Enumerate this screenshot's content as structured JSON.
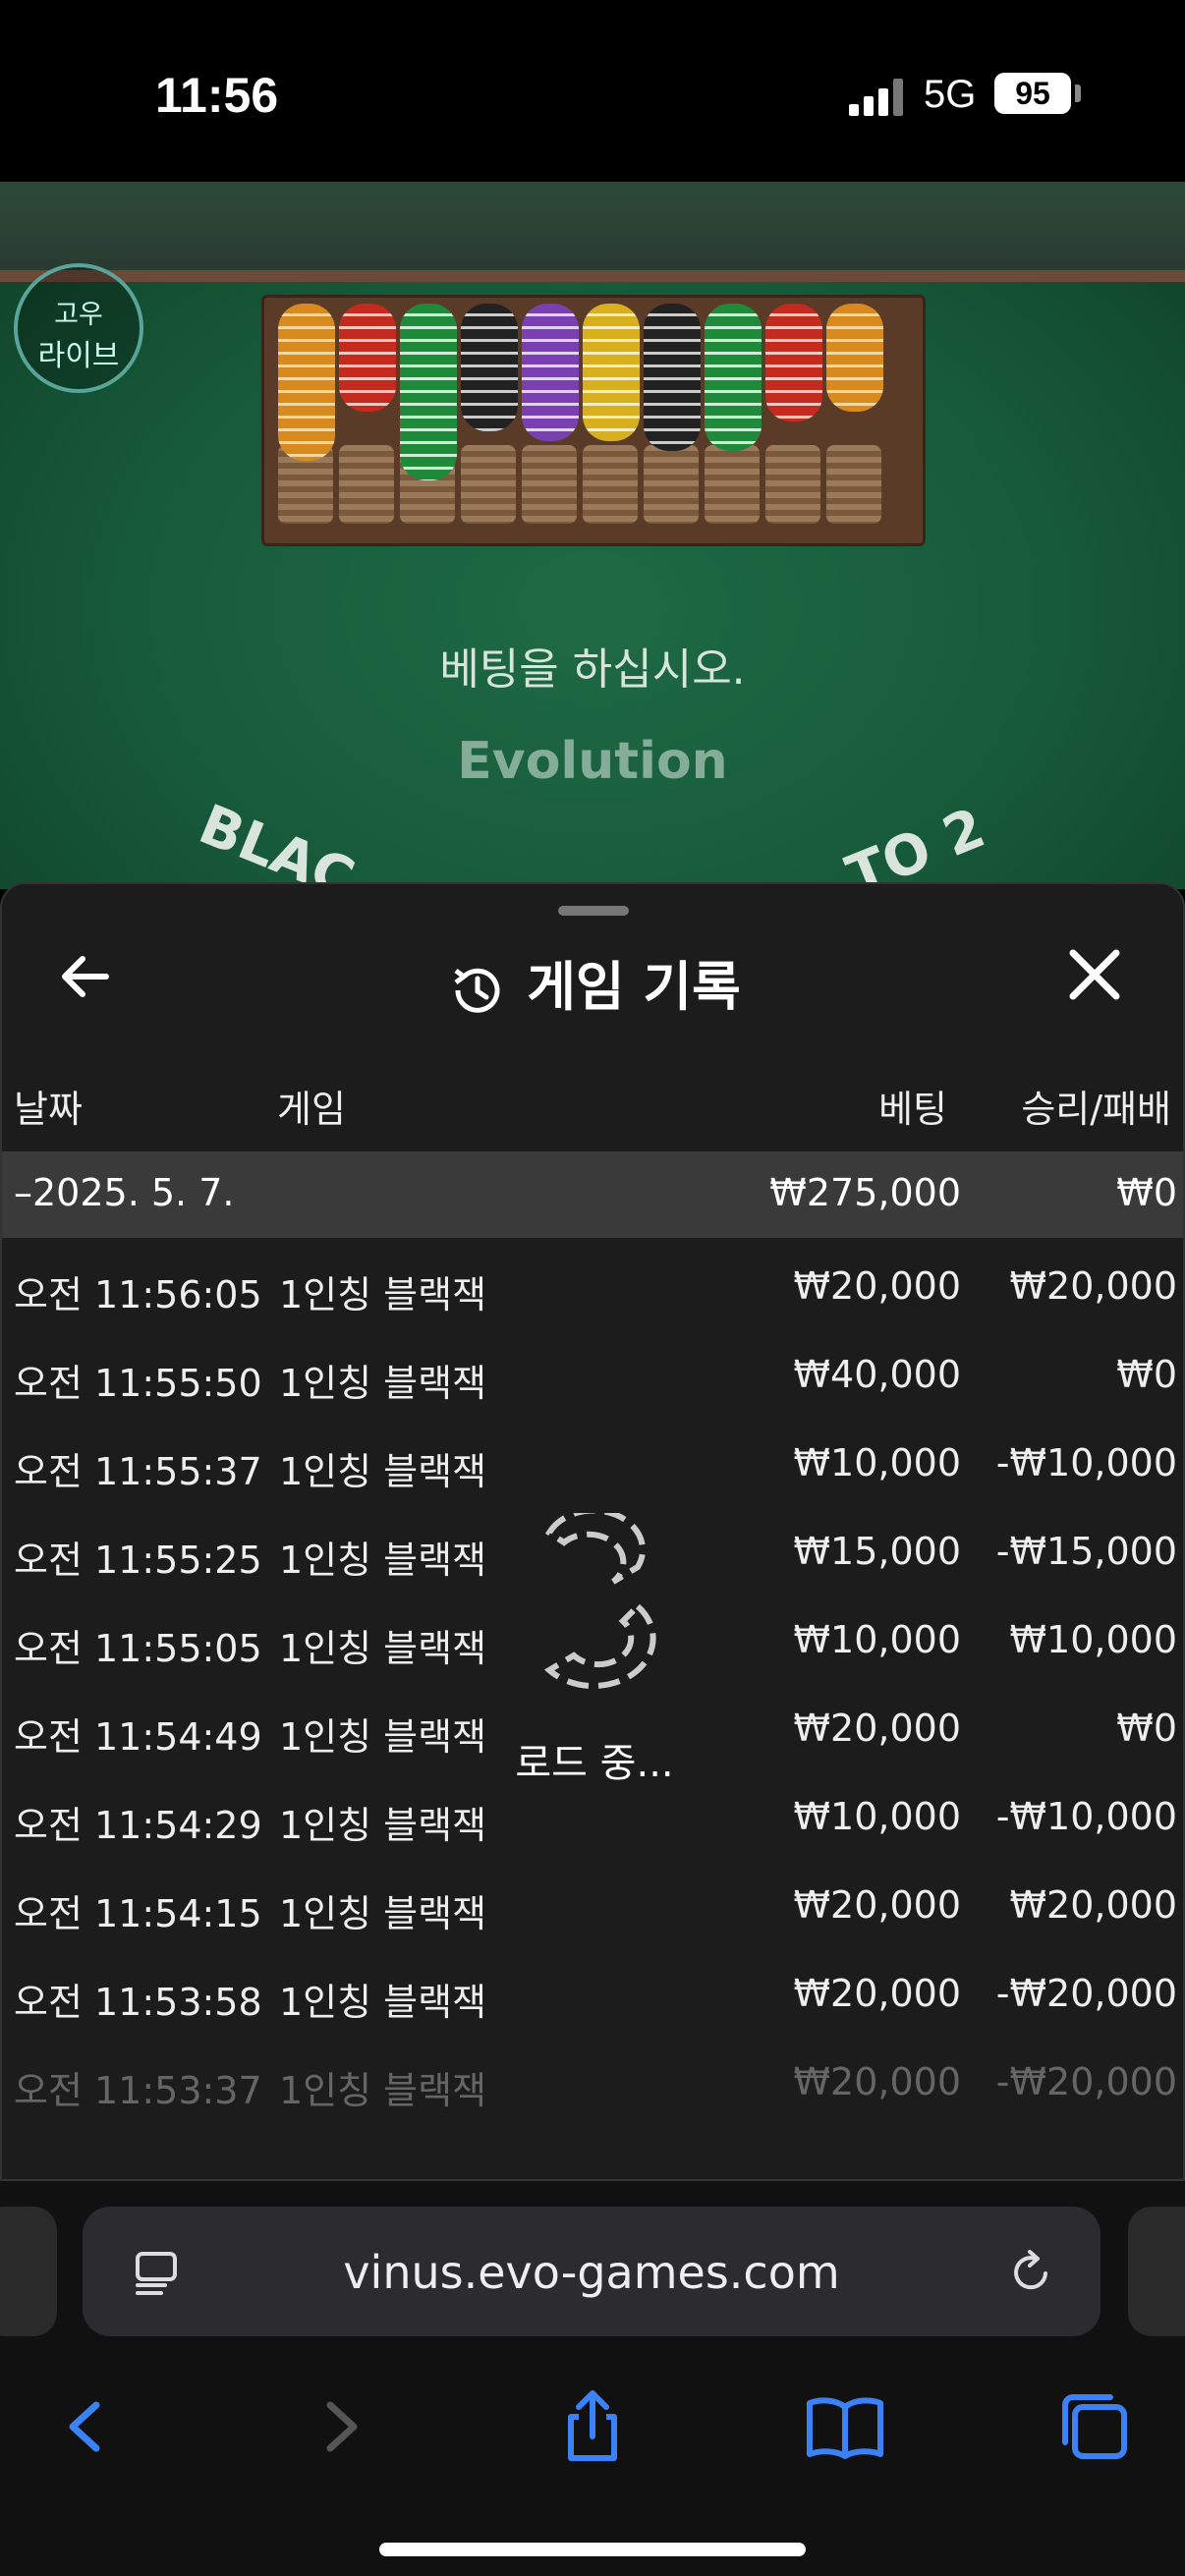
{
  "status_bar": {
    "time": "11:56",
    "network": "5G",
    "battery": "95"
  },
  "game": {
    "logo_line1": "고우",
    "logo_line2": "라이브",
    "message": "베팅을 하십시오.",
    "brand": "Evolution",
    "felt_left": "BLAC",
    "felt_right": "TO 2"
  },
  "panel": {
    "title": "게임 기록",
    "columns": {
      "date": "날짜",
      "game": "게임",
      "bet": "베팅",
      "result": "승리/패배"
    },
    "date_group": {
      "date": "–2025. 5. 7.",
      "bet_total": "₩275,000",
      "result_total": "₩0"
    },
    "rows": [
      {
        "time": "오전 11:56:05",
        "game": "1인칭 블랙잭",
        "bet": "₩20,000",
        "result": "₩20,000"
      },
      {
        "time": "오전 11:55:50",
        "game": "1인칭 블랙잭",
        "bet": "₩40,000",
        "result": "₩0"
      },
      {
        "time": "오전 11:55:37",
        "game": "1인칭 블랙잭",
        "bet": "₩10,000",
        "result": "-₩10,000"
      },
      {
        "time": "오전 11:55:25",
        "game": "1인칭 블랙잭",
        "bet": "₩15,000",
        "result": "-₩15,000"
      },
      {
        "time": "오전 11:55:05",
        "game": "1인칭 블랙잭",
        "bet": "₩10,000",
        "result": "₩10,000"
      },
      {
        "time": "오전 11:54:49",
        "game": "1인칭 블랙잭",
        "bet": "₩20,000",
        "result": "₩0"
      },
      {
        "time": "오전 11:54:29",
        "game": "1인칭 블랙잭",
        "bet": "₩10,000",
        "result": "-₩10,000"
      },
      {
        "time": "오전 11:54:15",
        "game": "1인칭 블랙잭",
        "bet": "₩20,000",
        "result": "₩20,000"
      },
      {
        "time": "오전 11:53:58",
        "game": "1인칭 블랙잭",
        "bet": "₩20,000",
        "result": "-₩20,000"
      },
      {
        "time": "오전 11:53:37",
        "game": "1인칭 블랙잭",
        "bet": "₩20,000",
        "result": "-₩20,000"
      }
    ],
    "loading": "로드 중..."
  },
  "browser": {
    "url": "vinus.evo-games.com"
  },
  "icons": {
    "back": "back-arrow-icon",
    "close": "close-icon",
    "history": "history-icon",
    "reader": "reader-icon",
    "reload": "reload-icon",
    "nav_back": "chevron-left-icon",
    "nav_forward": "chevron-right-icon",
    "share": "share-icon",
    "bookmarks": "book-icon",
    "tabs": "tabs-icon"
  },
  "colors": {
    "felt": "#175a3a",
    "panel": "#1c1c1c",
    "accent": "#3b82f6"
  }
}
